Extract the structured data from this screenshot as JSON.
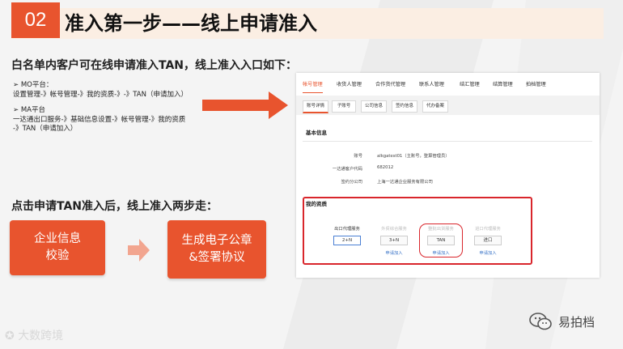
{
  "header": {
    "number": "02",
    "title": "准入第一步——线上申请准入"
  },
  "intro": {
    "heading": "白名单内客户可在线申请准入TAN，线上准入入口如下：",
    "mo_label": "➢  MO平台：",
    "mo_path": "设置管理-》帐号管理-》我的资质-》-》TAN（申请加入）",
    "ma_label": "➢  MA平台",
    "ma_path_1": "一达通出口服务-》基础信息设置-》帐号管理-》我的资质",
    "ma_path_2": "-》TAN（申请加入）"
  },
  "steps": {
    "heading": "点击申请TAN准入后，线上准入两步走：",
    "step1_line1": "企业信息",
    "step1_line2": "校验",
    "step2_line1": "生成电子公章",
    "step2_line2": "&签署协议"
  },
  "screenshot": {
    "nav": [
      "帐号管理",
      "收货人管理",
      "合作货代管理",
      "联系人管理",
      "结汇管理",
      "结算管理",
      "拍档管理"
    ],
    "tabs": [
      "账号详情",
      "子账号",
      "公司信息",
      "签约信息",
      "代办备案"
    ],
    "basic_info_title": "基本信息",
    "fields": [
      {
        "label": "账号",
        "value": "alkgatest01（主账号，登算管理员）"
      },
      {
        "label": "一达通客户代码",
        "value": "682012"
      },
      {
        "label": "签约分公司",
        "value": "上海一达通企业服务有限公司"
      }
    ],
    "qualification_title": "我的资质",
    "services": [
      {
        "name": "出口代理服务",
        "code": "2+N",
        "link": ""
      },
      {
        "name": "外贸综合服务",
        "code": "3+N",
        "link": "申请加入"
      },
      {
        "name": "整批出货服务",
        "code": "TAN",
        "link": "申请加入"
      },
      {
        "name": "进口代理服务",
        "code": "进口",
        "link": "申请加入"
      }
    ]
  },
  "footer": {
    "watermark": "大数跨境",
    "brand": "易拍档"
  },
  "colors": {
    "accent": "#e8542e",
    "highlight": "#d9262c",
    "link": "#3a74c8"
  }
}
